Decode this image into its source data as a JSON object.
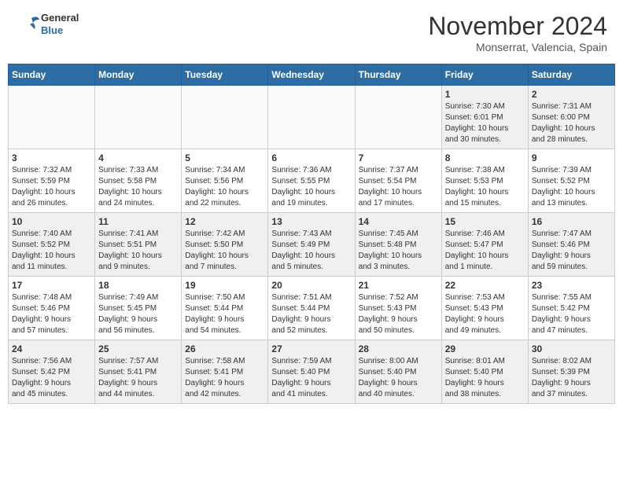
{
  "header": {
    "logo_line1": "General",
    "logo_line2": "Blue",
    "month": "November 2024",
    "location": "Monserrat, Valencia, Spain"
  },
  "weekdays": [
    "Sunday",
    "Monday",
    "Tuesday",
    "Wednesday",
    "Thursday",
    "Friday",
    "Saturday"
  ],
  "weeks": [
    [
      {
        "day": "",
        "info": ""
      },
      {
        "day": "",
        "info": ""
      },
      {
        "day": "",
        "info": ""
      },
      {
        "day": "",
        "info": ""
      },
      {
        "day": "",
        "info": ""
      },
      {
        "day": "1",
        "info": "Sunrise: 7:30 AM\nSunset: 6:01 PM\nDaylight: 10 hours\nand 30 minutes."
      },
      {
        "day": "2",
        "info": "Sunrise: 7:31 AM\nSunset: 6:00 PM\nDaylight: 10 hours\nand 28 minutes."
      }
    ],
    [
      {
        "day": "3",
        "info": "Sunrise: 7:32 AM\nSunset: 5:59 PM\nDaylight: 10 hours\nand 26 minutes."
      },
      {
        "day": "4",
        "info": "Sunrise: 7:33 AM\nSunset: 5:58 PM\nDaylight: 10 hours\nand 24 minutes."
      },
      {
        "day": "5",
        "info": "Sunrise: 7:34 AM\nSunset: 5:56 PM\nDaylight: 10 hours\nand 22 minutes."
      },
      {
        "day": "6",
        "info": "Sunrise: 7:36 AM\nSunset: 5:55 PM\nDaylight: 10 hours\nand 19 minutes."
      },
      {
        "day": "7",
        "info": "Sunrise: 7:37 AM\nSunset: 5:54 PM\nDaylight: 10 hours\nand 17 minutes."
      },
      {
        "day": "8",
        "info": "Sunrise: 7:38 AM\nSunset: 5:53 PM\nDaylight: 10 hours\nand 15 minutes."
      },
      {
        "day": "9",
        "info": "Sunrise: 7:39 AM\nSunset: 5:52 PM\nDaylight: 10 hours\nand 13 minutes."
      }
    ],
    [
      {
        "day": "10",
        "info": "Sunrise: 7:40 AM\nSunset: 5:52 PM\nDaylight: 10 hours\nand 11 minutes."
      },
      {
        "day": "11",
        "info": "Sunrise: 7:41 AM\nSunset: 5:51 PM\nDaylight: 10 hours\nand 9 minutes."
      },
      {
        "day": "12",
        "info": "Sunrise: 7:42 AM\nSunset: 5:50 PM\nDaylight: 10 hours\nand 7 minutes."
      },
      {
        "day": "13",
        "info": "Sunrise: 7:43 AM\nSunset: 5:49 PM\nDaylight: 10 hours\nand 5 minutes."
      },
      {
        "day": "14",
        "info": "Sunrise: 7:45 AM\nSunset: 5:48 PM\nDaylight: 10 hours\nand 3 minutes."
      },
      {
        "day": "15",
        "info": "Sunrise: 7:46 AM\nSunset: 5:47 PM\nDaylight: 10 hours\nand 1 minute."
      },
      {
        "day": "16",
        "info": "Sunrise: 7:47 AM\nSunset: 5:46 PM\nDaylight: 9 hours\nand 59 minutes."
      }
    ],
    [
      {
        "day": "17",
        "info": "Sunrise: 7:48 AM\nSunset: 5:46 PM\nDaylight: 9 hours\nand 57 minutes."
      },
      {
        "day": "18",
        "info": "Sunrise: 7:49 AM\nSunset: 5:45 PM\nDaylight: 9 hours\nand 56 minutes."
      },
      {
        "day": "19",
        "info": "Sunrise: 7:50 AM\nSunset: 5:44 PM\nDaylight: 9 hours\nand 54 minutes."
      },
      {
        "day": "20",
        "info": "Sunrise: 7:51 AM\nSunset: 5:44 PM\nDaylight: 9 hours\nand 52 minutes."
      },
      {
        "day": "21",
        "info": "Sunrise: 7:52 AM\nSunset: 5:43 PM\nDaylight: 9 hours\nand 50 minutes."
      },
      {
        "day": "22",
        "info": "Sunrise: 7:53 AM\nSunset: 5:43 PM\nDaylight: 9 hours\nand 49 minutes."
      },
      {
        "day": "23",
        "info": "Sunrise: 7:55 AM\nSunset: 5:42 PM\nDaylight: 9 hours\nand 47 minutes."
      }
    ],
    [
      {
        "day": "24",
        "info": "Sunrise: 7:56 AM\nSunset: 5:42 PM\nDaylight: 9 hours\nand 45 minutes."
      },
      {
        "day": "25",
        "info": "Sunrise: 7:57 AM\nSunset: 5:41 PM\nDaylight: 9 hours\nand 44 minutes."
      },
      {
        "day": "26",
        "info": "Sunrise: 7:58 AM\nSunset: 5:41 PM\nDaylight: 9 hours\nand 42 minutes."
      },
      {
        "day": "27",
        "info": "Sunrise: 7:59 AM\nSunset: 5:40 PM\nDaylight: 9 hours\nand 41 minutes."
      },
      {
        "day": "28",
        "info": "Sunrise: 8:00 AM\nSunset: 5:40 PM\nDaylight: 9 hours\nand 40 minutes."
      },
      {
        "day": "29",
        "info": "Sunrise: 8:01 AM\nSunset: 5:40 PM\nDaylight: 9 hours\nand 38 minutes."
      },
      {
        "day": "30",
        "info": "Sunrise: 8:02 AM\nSunset: 5:39 PM\nDaylight: 9 hours\nand 37 minutes."
      }
    ]
  ]
}
